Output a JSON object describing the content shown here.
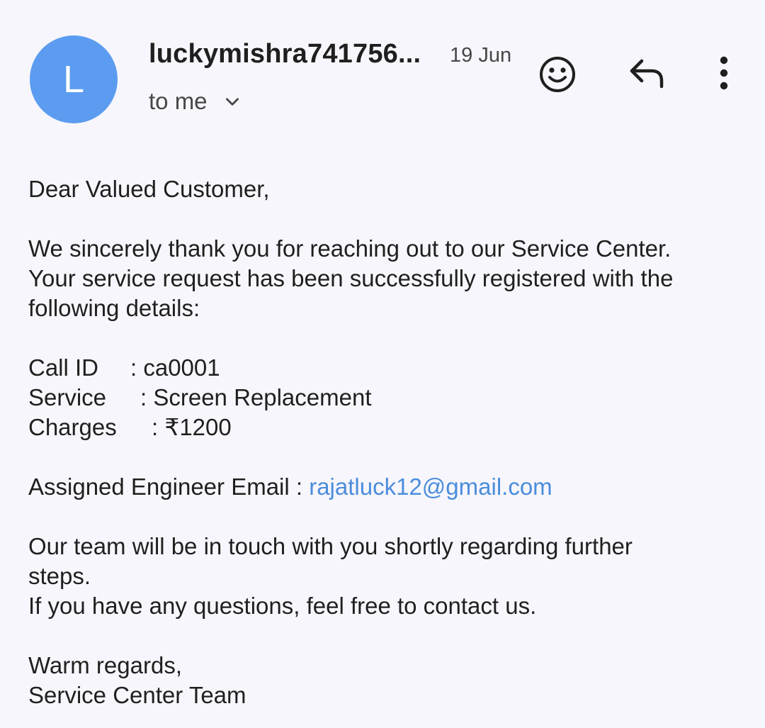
{
  "header": {
    "avatar_letter": "L",
    "sender": "luckymishra741756...",
    "date": "19 Jun",
    "recipient": "to me",
    "icons": [
      "smiley-icon",
      "reply-icon",
      "more-vertical-icon",
      "chevron-down-icon"
    ]
  },
  "body": {
    "greeting": "Dear Valued Customer,",
    "intro_line1": "We sincerely thank you for reaching out to our Service Center.",
    "intro_line2": "Your service request has been successfully registered with the",
    "intro_line3": "following details:",
    "details": [
      {
        "label": "Call ID",
        "value": ": ca0001"
      },
      {
        "label": "Service",
        "value": ": Screen Replacement"
      },
      {
        "label": "Charges",
        "value": ": ₹1200"
      }
    ],
    "engineer_label": "Assigned Engineer Email : ",
    "engineer_email": "rajatluck12@gmail.com",
    "followup_line1": "Our team will be in touch with you shortly regarding further",
    "followup_line2": "steps.",
    "followup_line3": "If you have any questions, feel free to contact us.",
    "signoff": "Warm regards,",
    "signature": "Service Center Team"
  },
  "colors": {
    "background": "#f7f6fc",
    "avatar": "#5b9cf0",
    "link": "#4a8ddc"
  }
}
